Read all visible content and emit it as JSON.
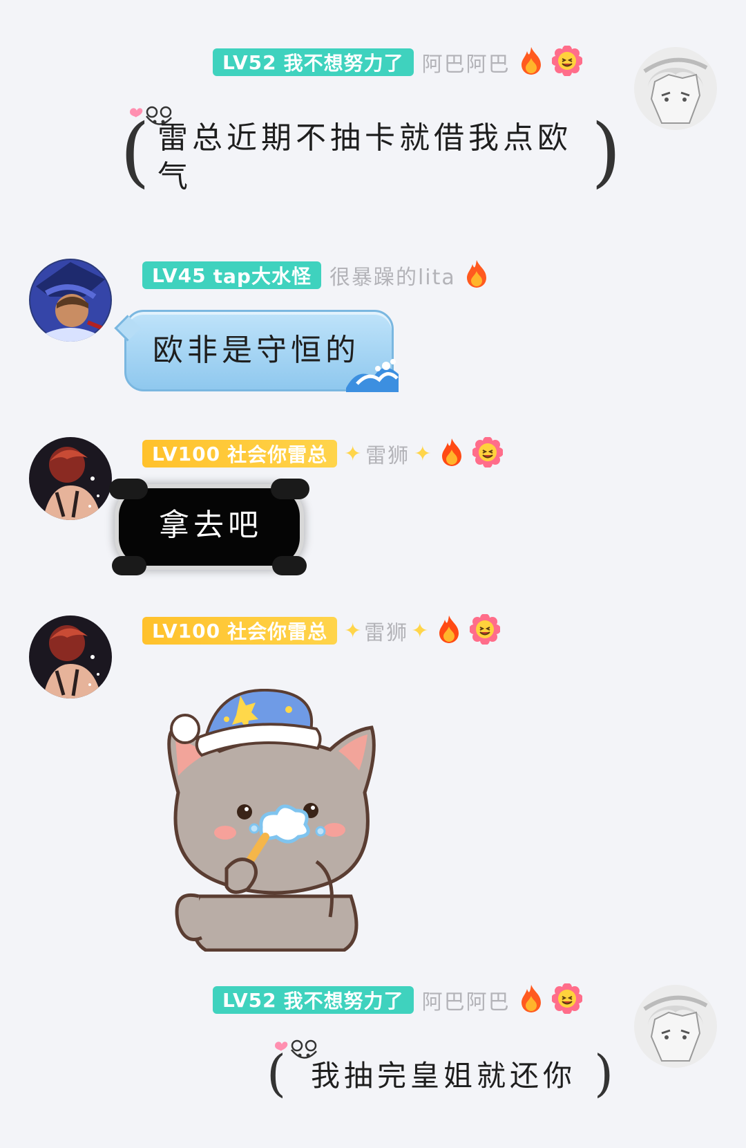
{
  "messages": [
    {
      "id": "m1",
      "side": "right",
      "level": "LV52",
      "title": "我不想努力了",
      "name": "阿巴阿巴",
      "text": "雷总近期不抽卡就借我点欧气"
    },
    {
      "id": "m2",
      "side": "left",
      "level": "LV45",
      "title": "tap大水怪",
      "name": "很暴躁的lita",
      "text": "欧非是守恒的"
    },
    {
      "id": "m3",
      "side": "left",
      "level": "LV100",
      "title": "社会你雷总",
      "name": "雷狮",
      "text": "拿去吧"
    },
    {
      "id": "m4",
      "side": "left",
      "level": "LV100",
      "title": "社会你雷总",
      "name": "雷狮",
      "sticker": "cat-brushing-teeth-sticker"
    },
    {
      "id": "m5",
      "side": "right",
      "level": "LV52",
      "title": "我不想努力了",
      "name": "阿巴阿巴",
      "text": "我抽完皇姐就还你"
    }
  ],
  "colors": {
    "background": "#f3f4f8",
    "teal_badge": "#3fd2be",
    "yellow_badge": "#ffc12b",
    "name_gray": "#b3b3b8",
    "blue_bubble": "#9ed2f3"
  },
  "icons": [
    "fire-icon",
    "smiley-flower-icon",
    "sparkle-icon",
    "mouse-icon"
  ]
}
